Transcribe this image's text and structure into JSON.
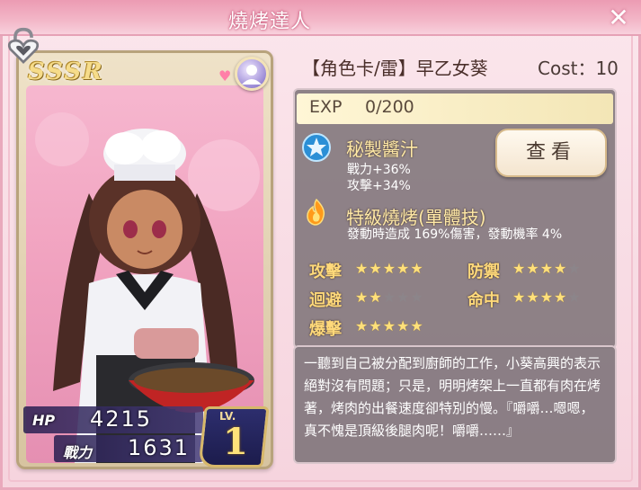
{
  "window": {
    "title": "燒烤達人"
  },
  "card": {
    "rarity": "SSSR",
    "hp_label": "HP",
    "hp": "4215",
    "power_label": "戰力",
    "power": "1631",
    "level_label": "LV.",
    "level": "1"
  },
  "info": {
    "name": "【角色卡/雷】早乙女葵",
    "cost": "Cost：10",
    "exp_label": "EXP",
    "exp_value": "0/200"
  },
  "skills": [
    {
      "icon": "star-badge-icon",
      "name": "秘製醬汁",
      "lines": [
        "戰力+36%",
        "攻擊+34%"
      ]
    },
    {
      "icon": "flame-icon",
      "name": "特級燒烤(單體技)",
      "lines": [
        "發動時造成 169%傷害，發動機率 4%"
      ]
    }
  ],
  "view_button": "查看",
  "attributes": [
    {
      "label": "攻擊",
      "stars": 5
    },
    {
      "label": "防禦",
      "stars": 4
    },
    {
      "label": "迴避",
      "stars": 2
    },
    {
      "label": "命中",
      "stars": 4
    },
    {
      "label": "爆擊",
      "stars": 5
    }
  ],
  "description": "一聽到自己被分配到廚師的工作，小葵高興的表示絕對沒有問題；只是，明明烤架上一直都有肉在烤著，烤肉的出餐速度卻特別的慢。『嚼嚼…嗯嗯，真不愧是頂級後腿肉呢！嚼嚼……』",
  "colors": {
    "accent": "#ec9bb3",
    "panel": "#766c72",
    "star": "#ffe07a"
  }
}
